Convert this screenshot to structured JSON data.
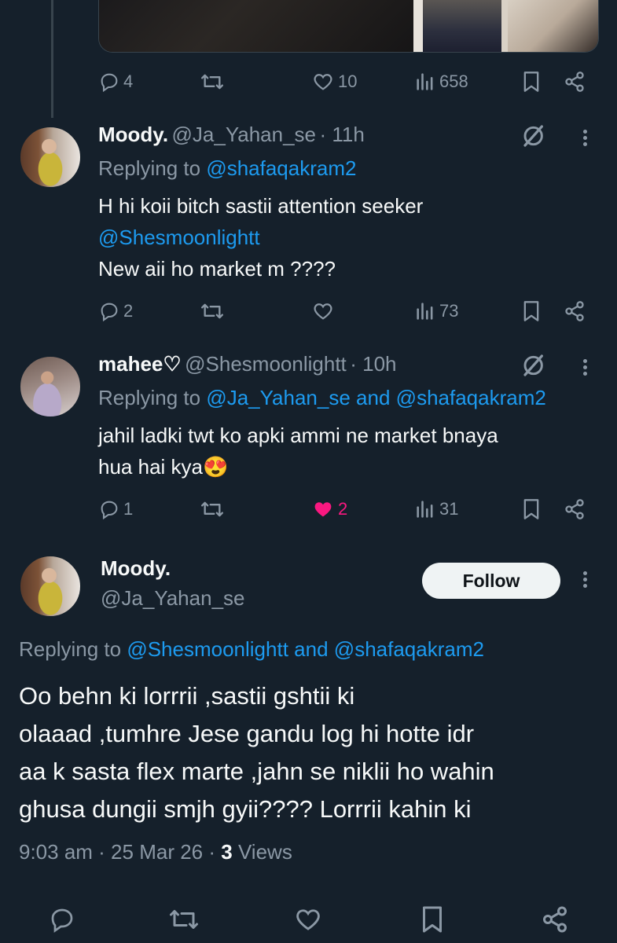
{
  "top_tweet": {
    "actions": {
      "replies": "4",
      "likes": "10",
      "views": "658"
    }
  },
  "reply1": {
    "name": "Moody.",
    "handle": "@Ja_Yahan_se",
    "time": "· 11h",
    "replying_prefix": "Replying to",
    "replying_to": "@shafaqakram2",
    "line1": "H hi koii bitch sastii attention seeker",
    "mention": "@Shesmoonlightt",
    "line3": "New aii ho market m ????",
    "actions": {
      "replies": "2",
      "views": "73"
    }
  },
  "reply2": {
    "name": "mahee♡",
    "handle": "@Shesmoonlightt",
    "time": "· 10h",
    "replying_prefix": "Replying to",
    "replying_to_1": "@Ja_Yahan_se",
    "replying_and": "and",
    "replying_to_2": "@shafaqakram2",
    "line1": "jahil ladki twt ko apki ammi ne market bnaya",
    "line2": "hua hai kya😍",
    "actions": {
      "replies": "1",
      "likes": "2",
      "views": "31"
    }
  },
  "main_tweet": {
    "name": "Moody.",
    "handle": "@Ja_Yahan_se",
    "follow_label": "Follow",
    "replying_prefix": "Replying to",
    "replying_to_1": "@Shesmoonlightt",
    "replying_and": "and",
    "replying_to_2": "@shafaqakram2",
    "line1": "Oo behn ki lorrrii ,sastii gshtii ki",
    "line2": "olaaad ,tumhre Jese gandu log hi hotte idr",
    "line3": "aa k sasta flex marte ,jahn se niklii ho wahin",
    "line4": "ghusa dungii smjh gyii???? Lorrrii kahin ki",
    "time": "9:03 am · 25 Mar 26 ·",
    "views_count": "3",
    "views_label": "Views"
  },
  "colors": {
    "background": "#15202b",
    "link": "#1d9bf0",
    "muted": "#8b98a5",
    "like_active": "#f91880"
  }
}
